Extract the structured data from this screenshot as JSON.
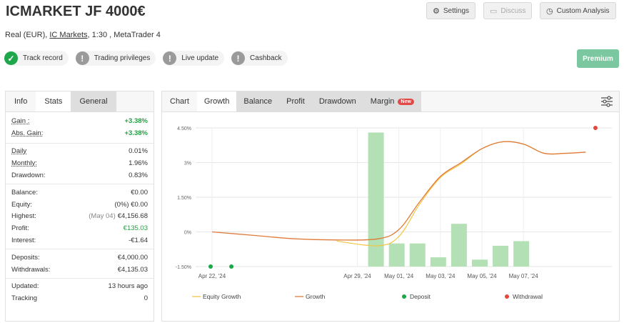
{
  "header": {
    "title": "ICMARKET JF 4000€",
    "settings_label": "Settings",
    "discuss_label": "Discuss",
    "custom_analysis_label": "Custom Analysis"
  },
  "account": {
    "type": "Real (EUR),",
    "broker": "IC Markets",
    "leverage": ", 1:30 , MetaTrader 4"
  },
  "badges": [
    {
      "label": "Track record",
      "status": "verified",
      "icon": "check-icon"
    },
    {
      "label": "Trading privileges",
      "status": "unverified",
      "icon": "exclamation-icon"
    },
    {
      "label": "Live update",
      "status": "unverified",
      "icon": "exclamation-icon"
    },
    {
      "label": "Cashback",
      "status": "unverified",
      "icon": "exclamation-icon"
    }
  ],
  "premium_label": "Premium",
  "left_tabs": [
    "Info",
    "Stats",
    "General"
  ],
  "stats": {
    "gain_label": "Gain :",
    "gain": "+3.38%",
    "abs_gain_label": "Abs. Gain:",
    "abs_gain": "+3.38%",
    "daily_label": "Daily",
    "daily": "0.01%",
    "monthly_label": "Monthly:",
    "monthly": "1.96%",
    "drawdown_label": "Drawdown:",
    "drawdown": "0.83%",
    "balance_label": "Balance:",
    "balance": "€0.00",
    "equity_label": "Equity:",
    "equity_pre": "(0%)",
    "equity": "€0.00",
    "highest_label": "Highest:",
    "highest_pre": "(May 04)",
    "highest": "€4,156.68",
    "profit_label": "Profit:",
    "profit": "€135.03",
    "interest_label": "Interest:",
    "interest": "-€1.64",
    "deposits_label": "Deposits:",
    "deposits": "€4,000.00",
    "withdrawals_label": "Withdrawals:",
    "withdrawals": "€4,135.03",
    "updated_label": "Updated:",
    "updated": "13 hours ago",
    "tracking_label": "Tracking",
    "tracking": "0"
  },
  "chart_tabs": [
    "Chart",
    "Growth",
    "Balance",
    "Profit",
    "Drawdown",
    "Margin"
  ],
  "new_badge": "New",
  "colors": {
    "equity": "#f2c744",
    "growth": "#e07b39",
    "bar": "#b3e0b5",
    "deposit": "#18a84a",
    "withdrawal": "#e2483d",
    "positive": "#23a042",
    "premium": "#7bc8a0"
  },
  "chart_data": {
    "type": "line",
    "ylim": [
      -1.5,
      4.5
    ],
    "y_ticks": [
      "4.50%",
      "3%",
      "1.50%",
      "0%",
      "-1.50%"
    ],
    "x_ticks": [
      "Apr 22, '24",
      "Apr 29, '24",
      "May 01, '24",
      "May 03, '24",
      "May 05, '24",
      "May 07, '24"
    ],
    "x_tick_days": [
      0,
      7,
      9,
      11,
      13,
      15
    ],
    "legend": [
      "Equity Growth",
      "Growth",
      "Deposit",
      "Withdrawal"
    ],
    "bars": {
      "name": "Daily",
      "x": [
        8,
        9,
        10,
        11,
        12,
        13,
        14,
        15
      ],
      "values": [
        4.3,
        -0.5,
        -0.5,
        -1.1,
        0.35,
        -1.2,
        -0.6,
        -0.4
      ]
    },
    "series": [
      {
        "name": "Growth",
        "x": [
          0,
          2,
          4,
          6,
          8,
          9,
          10,
          11,
          12,
          13,
          14,
          15,
          16,
          17,
          18
        ],
        "values": [
          0.0,
          -0.15,
          -0.3,
          -0.35,
          -0.3,
          0.1,
          1.3,
          2.4,
          3.0,
          3.6,
          3.9,
          3.8,
          3.4,
          3.4,
          3.45
        ]
      },
      {
        "name": "Equity Growth",
        "x": [
          6,
          8,
          9,
          10,
          11,
          12,
          13,
          14,
          15,
          16,
          17,
          18
        ],
        "values": [
          -0.4,
          -0.6,
          -0.2,
          1.2,
          2.35,
          2.95,
          3.6,
          3.9,
          3.8,
          3.4,
          3.4,
          3.45
        ]
      }
    ],
    "deposits": {
      "x": [
        0,
        1
      ],
      "values": [
        -1.5,
        -1.5
      ]
    },
    "withdrawals": {
      "x": [
        18
      ],
      "values": [
        4.5
      ]
    }
  }
}
